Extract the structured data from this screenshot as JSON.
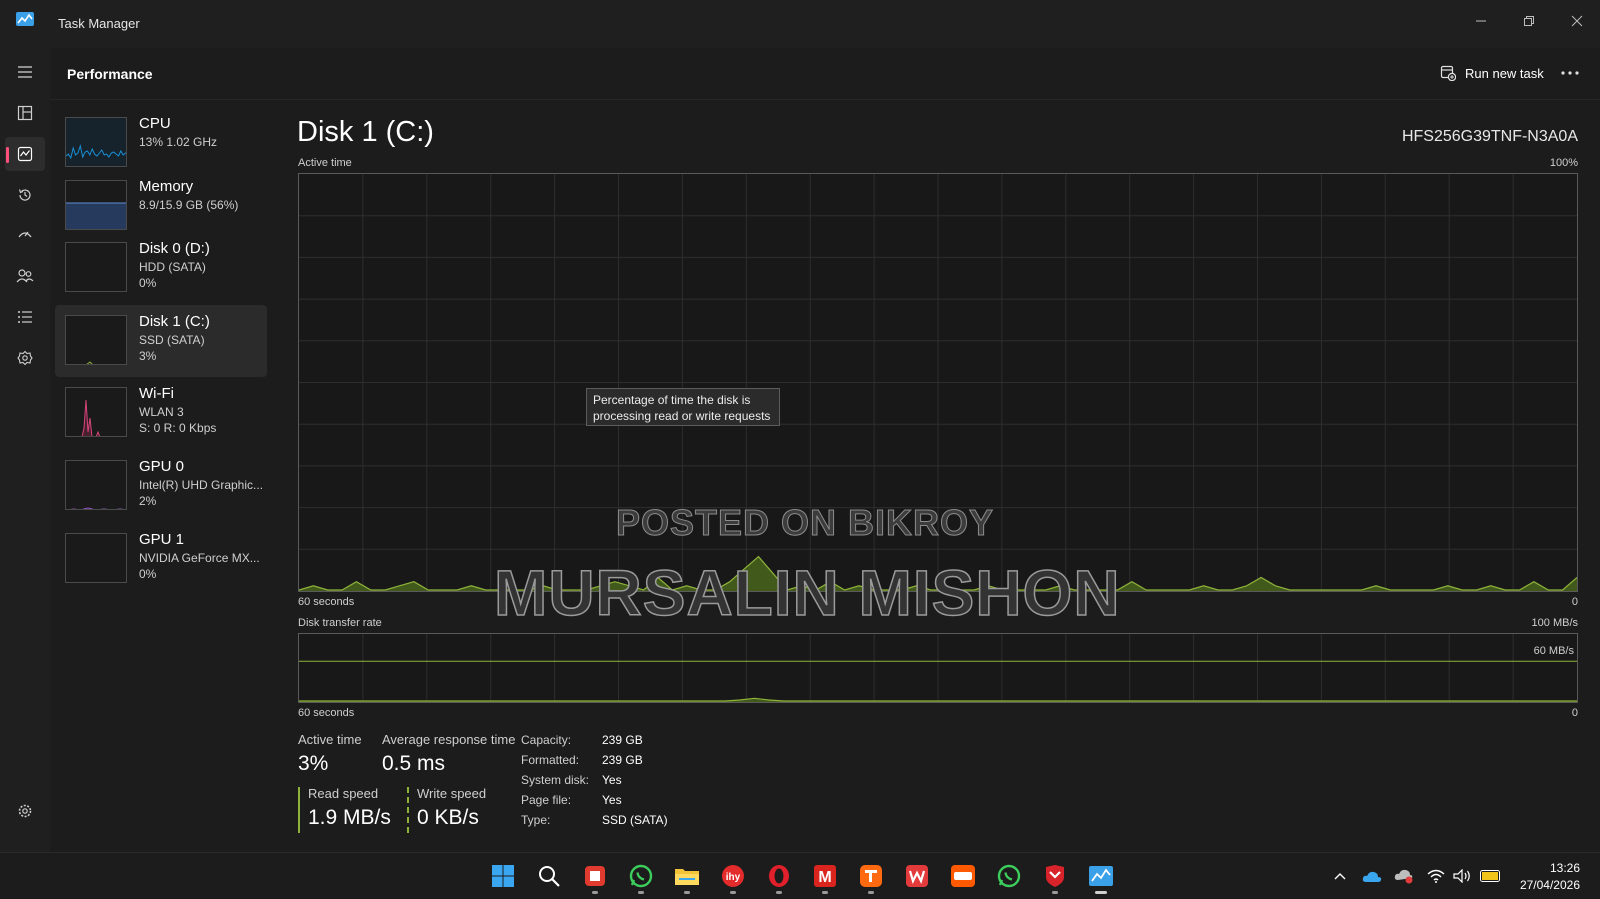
{
  "window": {
    "title": "Task Manager"
  },
  "nav": {
    "items": [
      "menu-icon",
      "processes-icon",
      "performance-icon",
      "app-history-icon",
      "startup-apps-icon",
      "users-icon",
      "details-icon",
      "services-icon"
    ],
    "settings": "gear-icon"
  },
  "header": {
    "title": "Performance",
    "run_new_task": "Run new task",
    "more": "..."
  },
  "sidebar": {
    "items": [
      {
        "name": "CPU",
        "line1": "13%  1.02 GHz",
        "line2": "",
        "color": "#1890d5"
      },
      {
        "name": "Memory",
        "line1": "8.9/15.9 GB (56%)",
        "line2": "",
        "color": "#5d8fd6"
      },
      {
        "name": "Disk 0 (D:)",
        "line1": "HDD (SATA)",
        "line2": "0%",
        "color": "#8fb23a"
      },
      {
        "name": "Disk 1 (C:)",
        "line1": "SSD (SATA)",
        "line2": "3%",
        "color": "#8fb23a"
      },
      {
        "name": "Wi-Fi",
        "line1": "WLAN 3",
        "line2": "S: 0  R: 0 Kbps",
        "color": "#d6457a"
      },
      {
        "name": "GPU 0",
        "line1": "Intel(R) UHD Graphic...",
        "line2": "2%",
        "color": "#9b59d0"
      },
      {
        "name": "GPU 1",
        "line1": "NVIDIA GeForce MX...",
        "line2": "0%",
        "color": "#9b59d0"
      }
    ]
  },
  "detail": {
    "title": "Disk 1 (C:)",
    "model": "HFS256G39TNF-N3A0A",
    "active_graph": {
      "label": "Active time",
      "max_label": "100%",
      "time_label": "60 seconds",
      "min_label": "0",
      "series": [
        0,
        1,
        0,
        0,
        2,
        0,
        0,
        1,
        2,
        0,
        0,
        0,
        1,
        0,
        0,
        0,
        0,
        1,
        0,
        0,
        0,
        1,
        2,
        1,
        0,
        3,
        0,
        1,
        0,
        0,
        2,
        5,
        8,
        4,
        0,
        1,
        0,
        2,
        0,
        1,
        0,
        0,
        0,
        1,
        0,
        0,
        0,
        0,
        1,
        0,
        0,
        0,
        0,
        1,
        0,
        0,
        0,
        0,
        2,
        0,
        0,
        0,
        0,
        1,
        0,
        0,
        1,
        3,
        1,
        0,
        0,
        0,
        0,
        0,
        0,
        1,
        0,
        0,
        0,
        0,
        1,
        0,
        0,
        1,
        0,
        0,
        2,
        0,
        0,
        3
      ]
    },
    "transfer_graph": {
      "label": "Disk transfer rate",
      "max_label": "100 MB/s",
      "ref_label": "60 MB/s",
      "time_label": "60 seconds",
      "min_label": "0",
      "series": [
        0,
        0,
        0,
        0,
        0,
        0,
        0,
        0,
        0,
        0,
        0,
        0,
        0,
        0,
        0,
        0,
        0,
        0,
        0,
        0,
        0,
        0,
        0,
        0,
        0,
        0,
        0,
        0,
        0,
        0,
        1.5,
        4,
        1.5,
        0,
        0,
        0,
        0,
        0,
        0,
        0,
        0,
        0,
        0,
        0,
        0,
        0,
        0,
        0,
        0,
        0,
        0,
        0,
        0,
        0,
        0,
        0,
        0,
        0,
        0,
        0,
        0,
        0,
        0,
        0,
        0,
        0,
        0,
        0,
        0,
        0,
        0,
        0,
        0,
        0,
        0,
        0,
        0,
        0,
        0,
        0,
        0,
        0,
        0,
        0,
        0,
        0,
        0,
        0
      ]
    },
    "tooltip": [
      "Percentage of time the disk is",
      "processing read or write requests"
    ],
    "stats": {
      "active_time_label": "Active time",
      "active_time_value": "3%",
      "avg_response_label": "Average response time",
      "avg_response_value": "0.5 ms",
      "read_label": "Read speed",
      "read_value": "1.9 MB/s",
      "write_label": "Write speed",
      "write_value": "0 KB/s"
    },
    "info": [
      {
        "label": "Capacity:",
        "value": "239 GB"
      },
      {
        "label": "Formatted:",
        "value": "239 GB"
      },
      {
        "label": "System disk:",
        "value": "Yes"
      },
      {
        "label": "Page file:",
        "value": "Yes"
      },
      {
        "label": "Type:",
        "value": "SSD (SATA)"
      }
    ]
  },
  "watermark": {
    "line1": "POSTED ON BIKROY",
    "line2": "MURSALIN MISHON"
  },
  "taskbar": {
    "apps": [
      "windows-start-icon",
      "search-icon",
      "app-red-icon",
      "whatsapp-icon",
      "file-explorer-icon",
      "app-ihy-icon",
      "opera-icon",
      "app-m-icon",
      "app-taobao-icon",
      "wps-icon",
      "app-1688-icon",
      "whatsapp-business-icon",
      "mcafee-icon",
      "task-manager-icon"
    ],
    "tray": [
      "chevron-up-icon",
      "onedrive-icon",
      "cloud-error-icon",
      "wifi-icon",
      "volume-icon",
      "battery-icon"
    ],
    "time": "13:26",
    "date": "27/04/2026"
  },
  "colors": {
    "disk_line": "#8fb23a",
    "disk_fill": "#415a1c",
    "accent": "#ff4f7b"
  }
}
